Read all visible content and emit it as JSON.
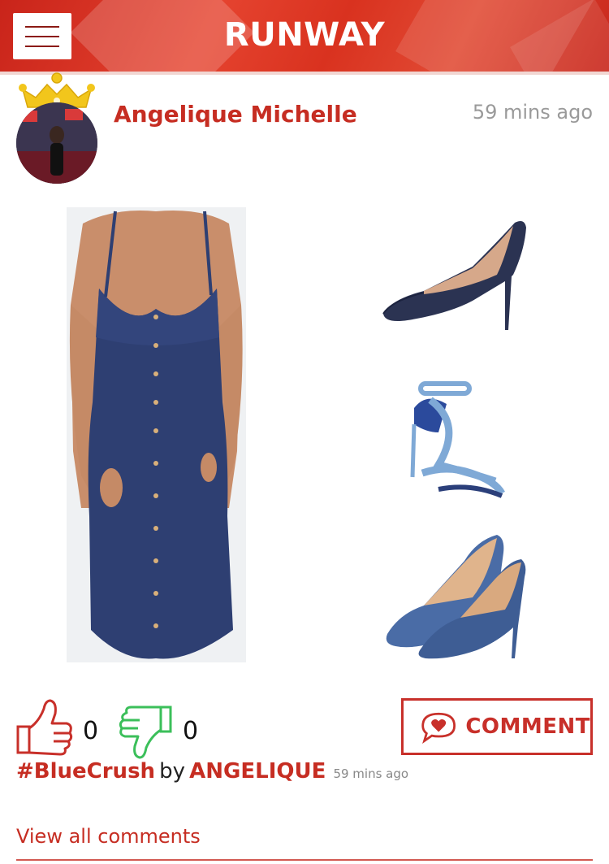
{
  "header": {
    "title": "RUNWAY",
    "menu_icon": "hamburger-menu-icon",
    "brand_color": "#d9321f"
  },
  "post": {
    "author": "Angelique Michelle",
    "time": "59 mins ago",
    "avatar_badge_icon": "crown-icon",
    "outfit_items": [
      "dress",
      "navy-denim-pump",
      "light-blue-strappy-sandal",
      "denim-pump"
    ],
    "likes": "0",
    "dislikes": "0",
    "comment_label": "COMMENT",
    "caption": {
      "hashtag": "#BlueCrush",
      "by": "by",
      "author": "ANGELIQUE",
      "time": "59 mins ago"
    },
    "view_comments": "View all comments"
  },
  "colors": {
    "accent": "#c62d22",
    "like_icon": "#c8302a",
    "dislike_icon": "#3bbf5a"
  }
}
